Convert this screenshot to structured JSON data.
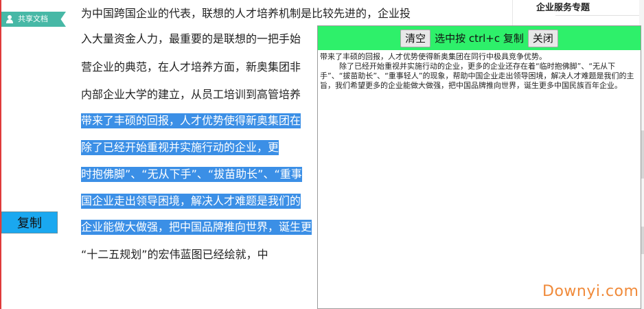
{
  "left_panel": {
    "share_label": "共享文档",
    "copy_button": "复制"
  },
  "article_lines": [
    {
      "text": "为中国跨国企业的代表，联想的人才培养机制是比较先进的，企业投",
      "selected": false
    },
    {
      "text": "入大量资金人力，最重要的是联想的一把手始",
      "selected": false
    },
    {
      "text": "营企业的典范，在人才培养方面，新奥集团非",
      "selected": false
    },
    {
      "text": "内部企业大学的建立，从员工培训到高管培养",
      "selected": false
    },
    {
      "text": "带来了丰硕的回报，人才优势使得新奥集团在",
      "selected": true
    },
    {
      "text": "    除了已经开始重视并实施行动的企业，更",
      "selected": true
    },
    {
      "text": "时抱佛脚”、“无从下手”、“拔苗助长”、“重事",
      "selected": true
    },
    {
      "text": "国企业走出领导困境，解决人才难题是我们的",
      "selected": true
    },
    {
      "text": "企业能做大做强，把中国品牌推向世界，诞生更",
      "selected": true
    },
    {
      "text": "    “十二五规划”的宏伟蓝图已经绘就，中",
      "selected": false
    }
  ],
  "sidebar": {
    "title": "企业服务专题"
  },
  "popup": {
    "clear_button": "清空",
    "hint": "选中按 ctrl+c 复制",
    "close_button": "关闭",
    "content": "带来了丰硕的回报，人才优势使得新奥集团在同行中极具竞争优势。\n        除了已经开始重视并实施行动的企业，更多的企业还存在着“临时抱佛脚”、“无从下手”、“拔苗助长”、“重事轻人”的现象，帮助中国企业走出领导困境，解决人才难题是我们的主旨，我们希望更多的企业能做大做强，把中国品牌推向世界，诞生更多中国民族百年企业。"
  },
  "watermark": "Downyi.com"
}
